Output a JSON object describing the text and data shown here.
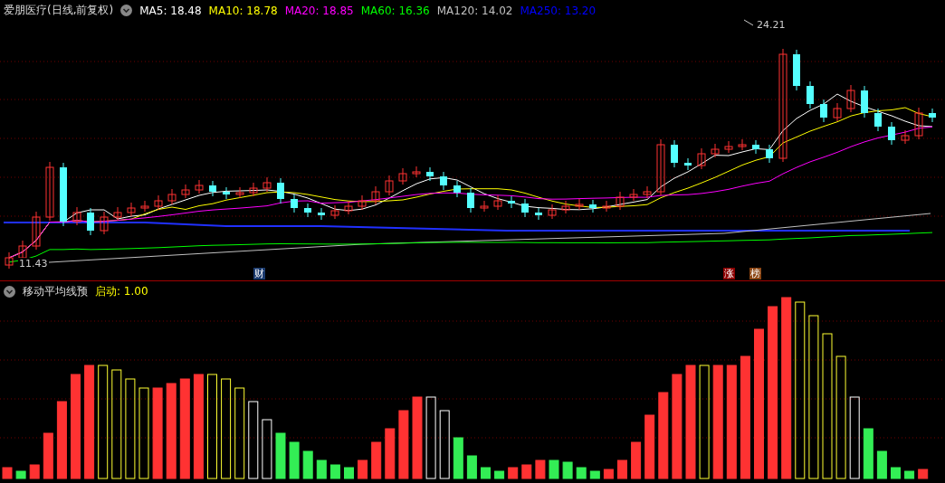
{
  "chart_title": "爱朋医疗(日线,前复权)",
  "ma_legend": [
    {
      "label": "MA5: 18.48",
      "color": "#ffffff"
    },
    {
      "label": "MA10: 18.78",
      "color": "#ffff00"
    },
    {
      "label": "MA20: 18.85",
      "color": "#ff00ff"
    },
    {
      "label": "MA60: 16.36",
      "color": "#00ff00"
    },
    {
      "label": "MA120: 14.02",
      "color": "#c0c0c0"
    },
    {
      "label": "MA250: 13.20",
      "color": "#0000ff"
    }
  ],
  "high_label": "24.21",
  "low_label": "11.43",
  "markers": [
    {
      "text": "财",
      "color": "#1a3a6e"
    },
    {
      "text": "涨",
      "color": "#8b0000"
    },
    {
      "text": "榜",
      "color": "#8b4513"
    }
  ],
  "indicator": {
    "name": "移动平均线预",
    "param": "启动: 1.00"
  }
}
